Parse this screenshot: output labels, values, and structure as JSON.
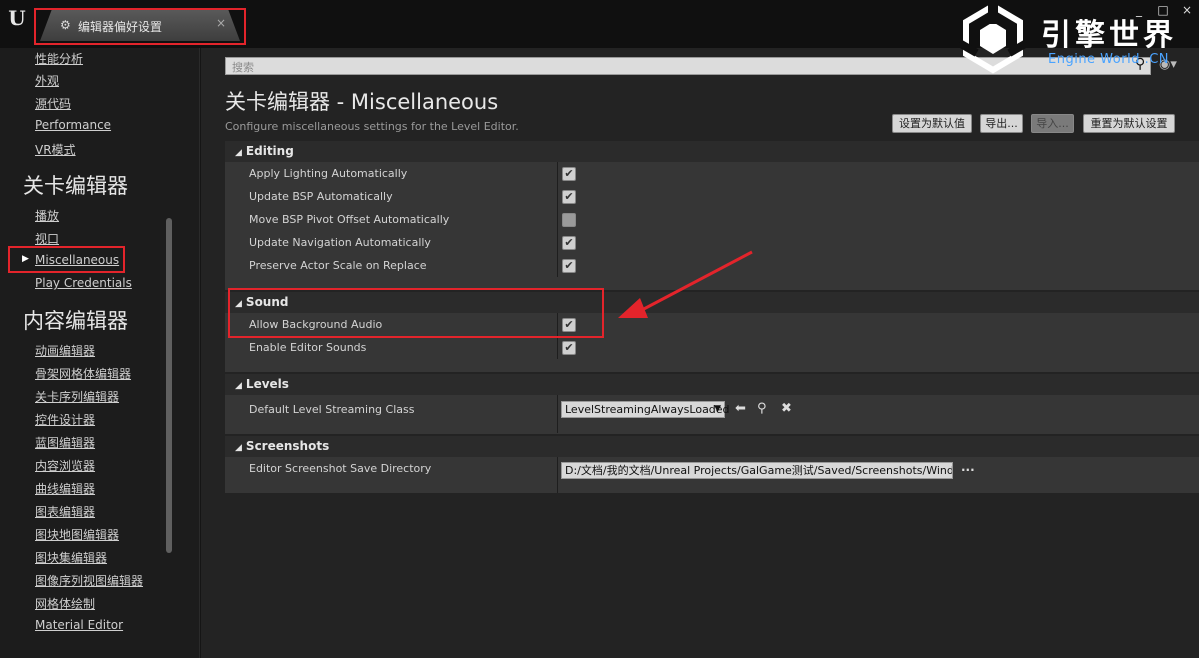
{
  "window": {
    "logo": "U",
    "tab_label": "编辑器偏好设置",
    "tab_close": "×",
    "min": "_",
    "max": "□",
    "close": "×"
  },
  "watermark": {
    "brand": "引擎世界",
    "sub": "Engine World .CN"
  },
  "sidebar": {
    "items_top": [
      "性能分析",
      "外观",
      "源代码",
      "Performance",
      "VR模式"
    ],
    "heading_level": "关卡编辑器",
    "items_level": [
      "播放",
      "视口",
      "Miscellaneous",
      "Play Credentials"
    ],
    "heading_content": "内容编辑器",
    "items_content": [
      "动画编辑器",
      "骨架网格体编辑器",
      "关卡序列编辑器",
      "控件设计器",
      "蓝图编辑器",
      "内容浏览器",
      "曲线编辑器",
      "图表编辑器",
      "图块地图编辑器",
      "图块集编辑器",
      "图像序列视图编辑器",
      "网格体绘制",
      "Material Editor"
    ]
  },
  "main": {
    "search_placeholder": "搜索",
    "title": "关卡编辑器 - Miscellaneous",
    "description": "Configure miscellaneous settings for the Level Editor.",
    "buttons": {
      "set_default": "设置为默认值",
      "export": "导出...",
      "import": "导入...",
      "reset_default": "重置为默认设置"
    },
    "categories": {
      "editing": {
        "title": "Editing",
        "props": [
          {
            "name": "Apply Lighting Automatically",
            "checked": true
          },
          {
            "name": "Update BSP Automatically",
            "checked": true
          },
          {
            "name": "Move BSP Pivot Offset Automatically",
            "checked": false
          },
          {
            "name": "Update Navigation Automatically",
            "checked": true
          },
          {
            "name": "Preserve Actor Scale on Replace",
            "checked": true
          }
        ]
      },
      "sound": {
        "title": "Sound",
        "props": [
          {
            "name": "Allow Background Audio",
            "checked": true
          },
          {
            "name": "Enable Editor Sounds",
            "checked": true
          }
        ]
      },
      "levels": {
        "title": "Levels",
        "prop_name": "Default Level Streaming Class",
        "value": "LevelStreamingAlwaysLoaded"
      },
      "screenshots": {
        "title": "Screenshots",
        "prop_name": "Editor Screenshot Save Directory",
        "value": "D:/文档/我的文档/Unreal Projects/GalGame测试/Saved/Screenshots/Windows/",
        "browse": "..."
      }
    }
  },
  "colors": {
    "highlight": "#e3242b",
    "checkbox": "#d0d0d0",
    "panel": "#363636"
  }
}
